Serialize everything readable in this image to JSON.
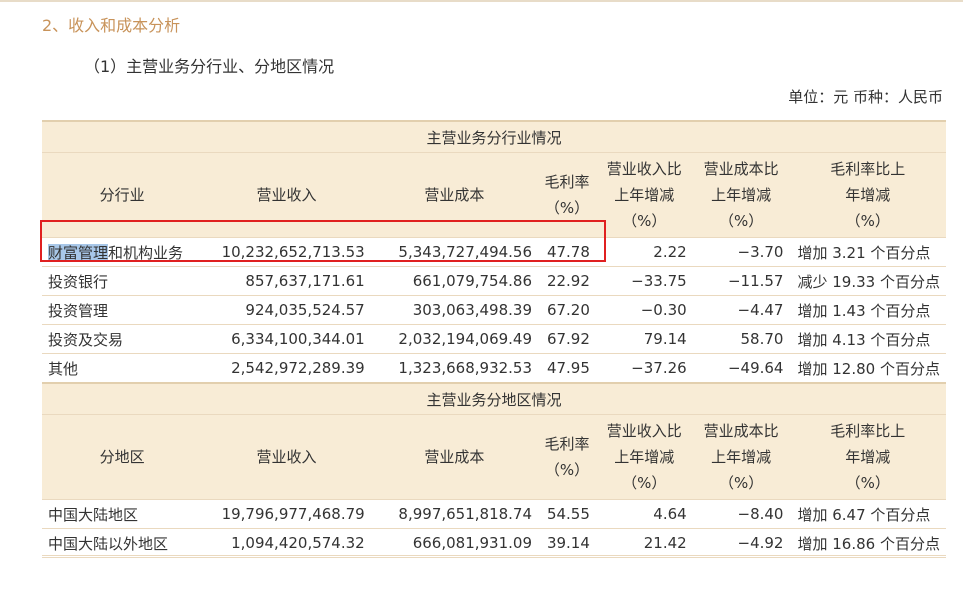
{
  "section_title": "2、收入和成本分析",
  "sub_title": "（1）主营业务分行业、分地区情况",
  "unit": "单位：元  币种：人民币",
  "industry": {
    "group_title": "主营业务分行业情况",
    "headers": [
      "分行业",
      "营业收入",
      "营业成本",
      "毛利率（%）",
      "营业收入比上年增减（%）",
      "营业成本比上年增减（%）",
      "毛利率比上年增减（%）"
    ],
    "first_row_highlight": "财富管理",
    "first_row_rest": "和机构业务",
    "rows": [
      [
        "财富管理和机构业务",
        "10,232,652,713.53",
        "5,343,727,494.56",
        "47.78",
        "2.22",
        "−3.70",
        "增加 3.21 个百分点"
      ],
      [
        "投资银行",
        "857,637,171.61",
        "661,079,754.86",
        "22.92",
        "−33.75",
        "−11.57",
        "减少 19.33 个百分点"
      ],
      [
        "投资管理",
        "924,035,524.57",
        "303,063,498.39",
        "67.20",
        "−0.30",
        "−4.47",
        "增加 1.43 个百分点"
      ],
      [
        "投资及交易",
        "6,334,100,344.01",
        "2,032,194,069.49",
        "67.92",
        "79.14",
        "58.70",
        "增加 4.13 个百分点"
      ],
      [
        "其他",
        "2,542,972,289.39",
        "1,323,668,932.53",
        "47.95",
        "−37.26",
        "−49.64",
        "增加 12.80 个百分点"
      ]
    ]
  },
  "region": {
    "group_title": "主营业务分地区情况",
    "headers": [
      "分地区",
      "营业收入",
      "营业成本",
      "毛利率（%）",
      "营业收入比上年增减（%）",
      "营业成本比上年增减（%）",
      "毛利率比上年增减（%）"
    ],
    "rows": [
      [
        "中国大陆地区",
        "19,796,977,468.79",
        "8,997,651,818.74",
        "54.55",
        "4.64",
        "−8.40",
        "增加 6.47 个百分点"
      ],
      [
        "中国大陆以外地区",
        "1,094,420,574.32",
        "666,081,931.09",
        "39.14",
        "21.42",
        "−4.92",
        "增加 16.86 个百分点"
      ]
    ]
  }
}
